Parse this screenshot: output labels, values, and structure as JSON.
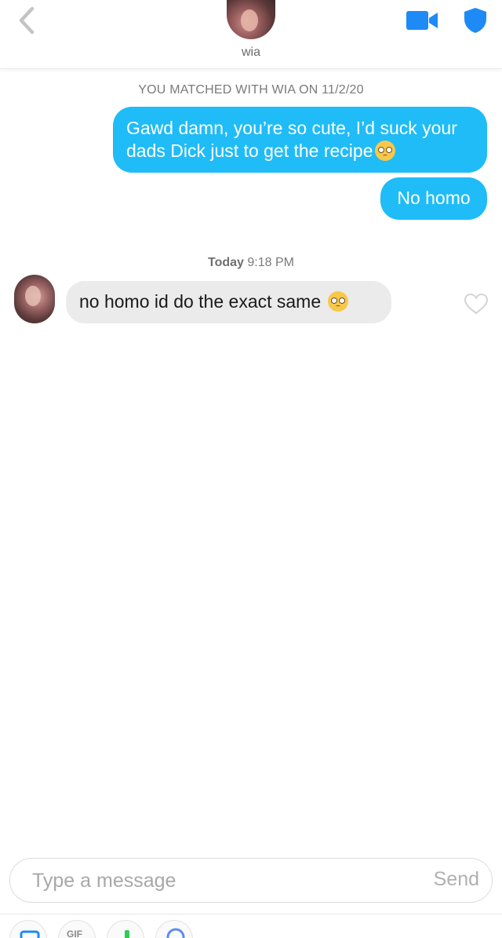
{
  "header": {
    "name": "wia",
    "back_icon": "chevron-left-icon",
    "video_icon": "video-camera-icon",
    "shield_icon": "shield-icon",
    "accent_color": "#1e8af5"
  },
  "conversation": {
    "matched_text": "YOU MATCHED WITH WIA ON 11/2/20",
    "outgoing": [
      {
        "text": "Gawd damn, you’re so cute, I’d suck your dads Dick just to get the recipe",
        "emoji": "pleading-face-emoji"
      },
      {
        "text": "No homo"
      }
    ],
    "time_divider": {
      "day": "Today",
      "time": "9:18 PM"
    },
    "incoming": [
      {
        "text": "no homo id do the exact same",
        "emoji": "pleading-face-emoji"
      }
    ],
    "outgoing_bubble_color": "#1fbcf7",
    "incoming_bubble_color": "#ebebeb"
  },
  "composer": {
    "placeholder": "Type a message",
    "value": "",
    "send_label": "Send",
    "tools": [
      {
        "icon": "sticker-icon"
      },
      {
        "icon": "gif-icon",
        "label": "GIF"
      },
      {
        "icon": "music-icon"
      },
      {
        "icon": "reaction-icon"
      }
    ]
  }
}
